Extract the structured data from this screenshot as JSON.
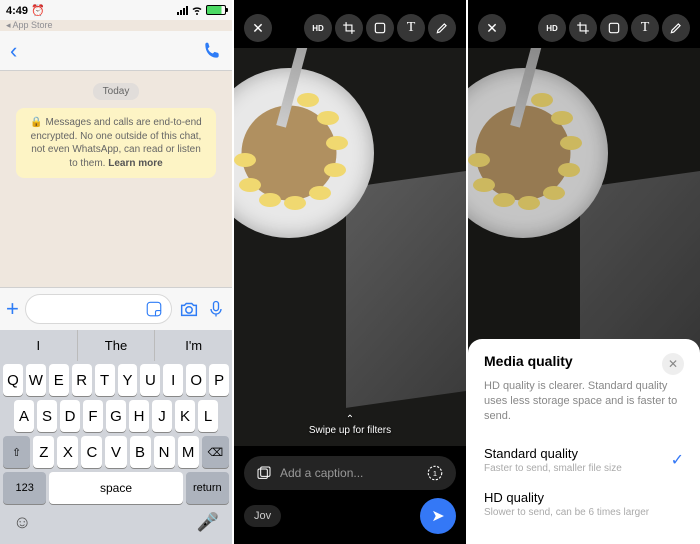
{
  "panel1": {
    "status": {
      "time": "4:49",
      "back_app": "◂ App Store"
    },
    "chat": {
      "date": "Today",
      "encryption_notice": "🔒 Messages and calls are end-to-end encrypted. No one outside of this chat, not even WhatsApp, can read or listen to them.",
      "learn_more": "Learn more"
    },
    "suggestions": [
      "I",
      "The",
      "I'm"
    ],
    "keyboard": {
      "row1": [
        "Q",
        "W",
        "E",
        "R",
        "T",
        "Y",
        "U",
        "I",
        "O",
        "P"
      ],
      "row2": [
        "A",
        "S",
        "D",
        "F",
        "G",
        "H",
        "J",
        "K",
        "L"
      ],
      "row3": [
        "Z",
        "X",
        "C",
        "V",
        "B",
        "N",
        "M"
      ],
      "shift": "⇧",
      "backspace": "⌫",
      "numbers": "123",
      "space": "space",
      "return": "return"
    }
  },
  "panel2": {
    "tools": {
      "hd": "HD",
      "crop": "crop",
      "sticker": "sticker",
      "text": "T",
      "draw": "draw"
    },
    "swipe_hint": "Swipe up for filters",
    "caption_placeholder": "Add a caption...",
    "recipient": "Jov"
  },
  "panel3": {
    "sheet": {
      "title": "Media quality",
      "desc": "HD quality is clearer. Standard quality uses less storage space and is faster to send.",
      "options": [
        {
          "title": "Standard quality",
          "sub": "Faster to send, smaller file size",
          "selected": true
        },
        {
          "title": "HD quality",
          "sub": "Slower to send, can be 6 times larger",
          "selected": false
        }
      ]
    }
  }
}
